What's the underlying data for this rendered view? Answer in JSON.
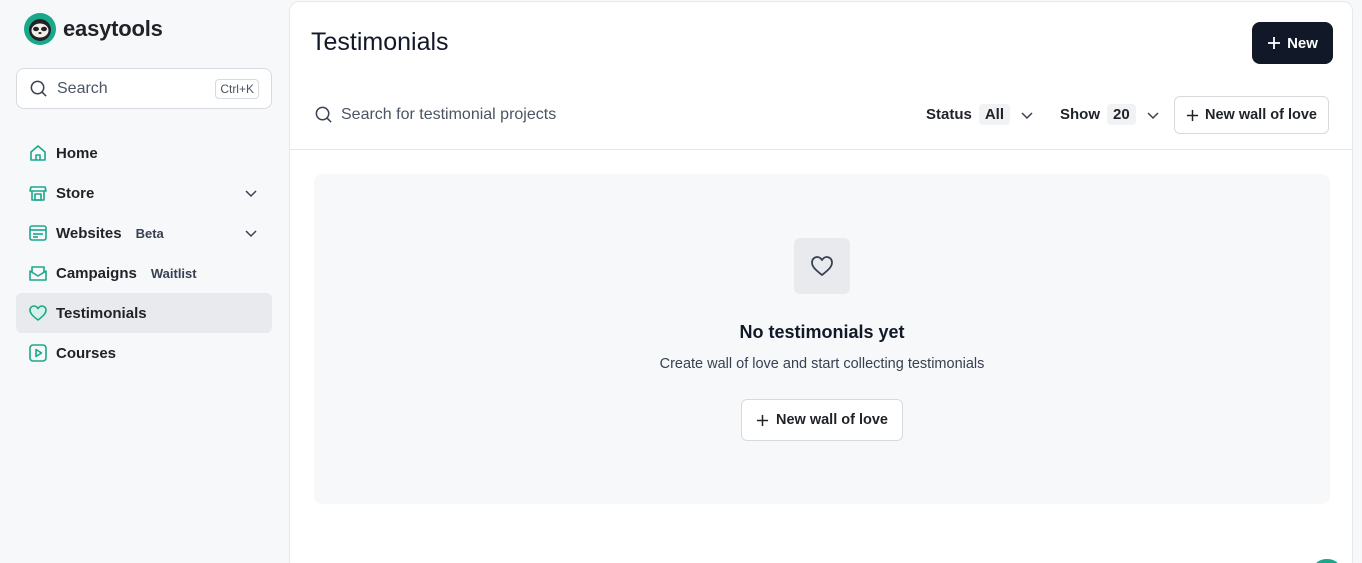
{
  "brand": {
    "name": "easytools"
  },
  "search": {
    "placeholder": "Search",
    "shortcut": "Ctrl+K"
  },
  "sidebar": {
    "items": [
      {
        "label": "Home",
        "icon": "home-icon"
      },
      {
        "label": "Store",
        "icon": "store-icon",
        "expandable": true
      },
      {
        "label": "Websites",
        "badge": "Beta",
        "icon": "website-icon",
        "expandable": true
      },
      {
        "label": "Campaigns",
        "badge": "Waitlist",
        "icon": "mail-icon"
      },
      {
        "label": "Testimonials",
        "icon": "heart-icon",
        "active": true
      },
      {
        "label": "Courses",
        "icon": "play-icon"
      }
    ]
  },
  "main": {
    "title": "Testimonials",
    "new_button": "New",
    "search_placeholder": "Search for testimonial projects",
    "status_label": "Status",
    "status_value": "All",
    "show_label": "Show",
    "show_value": "20",
    "new_wall_button": "New wall of love"
  },
  "empty_state": {
    "title": "No testimonials yet",
    "description": "Create wall of love and start collecting testimonials",
    "button": "New wall of love"
  },
  "colors": {
    "accent": "#1aa88b",
    "dark": "#111827",
    "sidebar_bg": "#f7f8fa"
  }
}
